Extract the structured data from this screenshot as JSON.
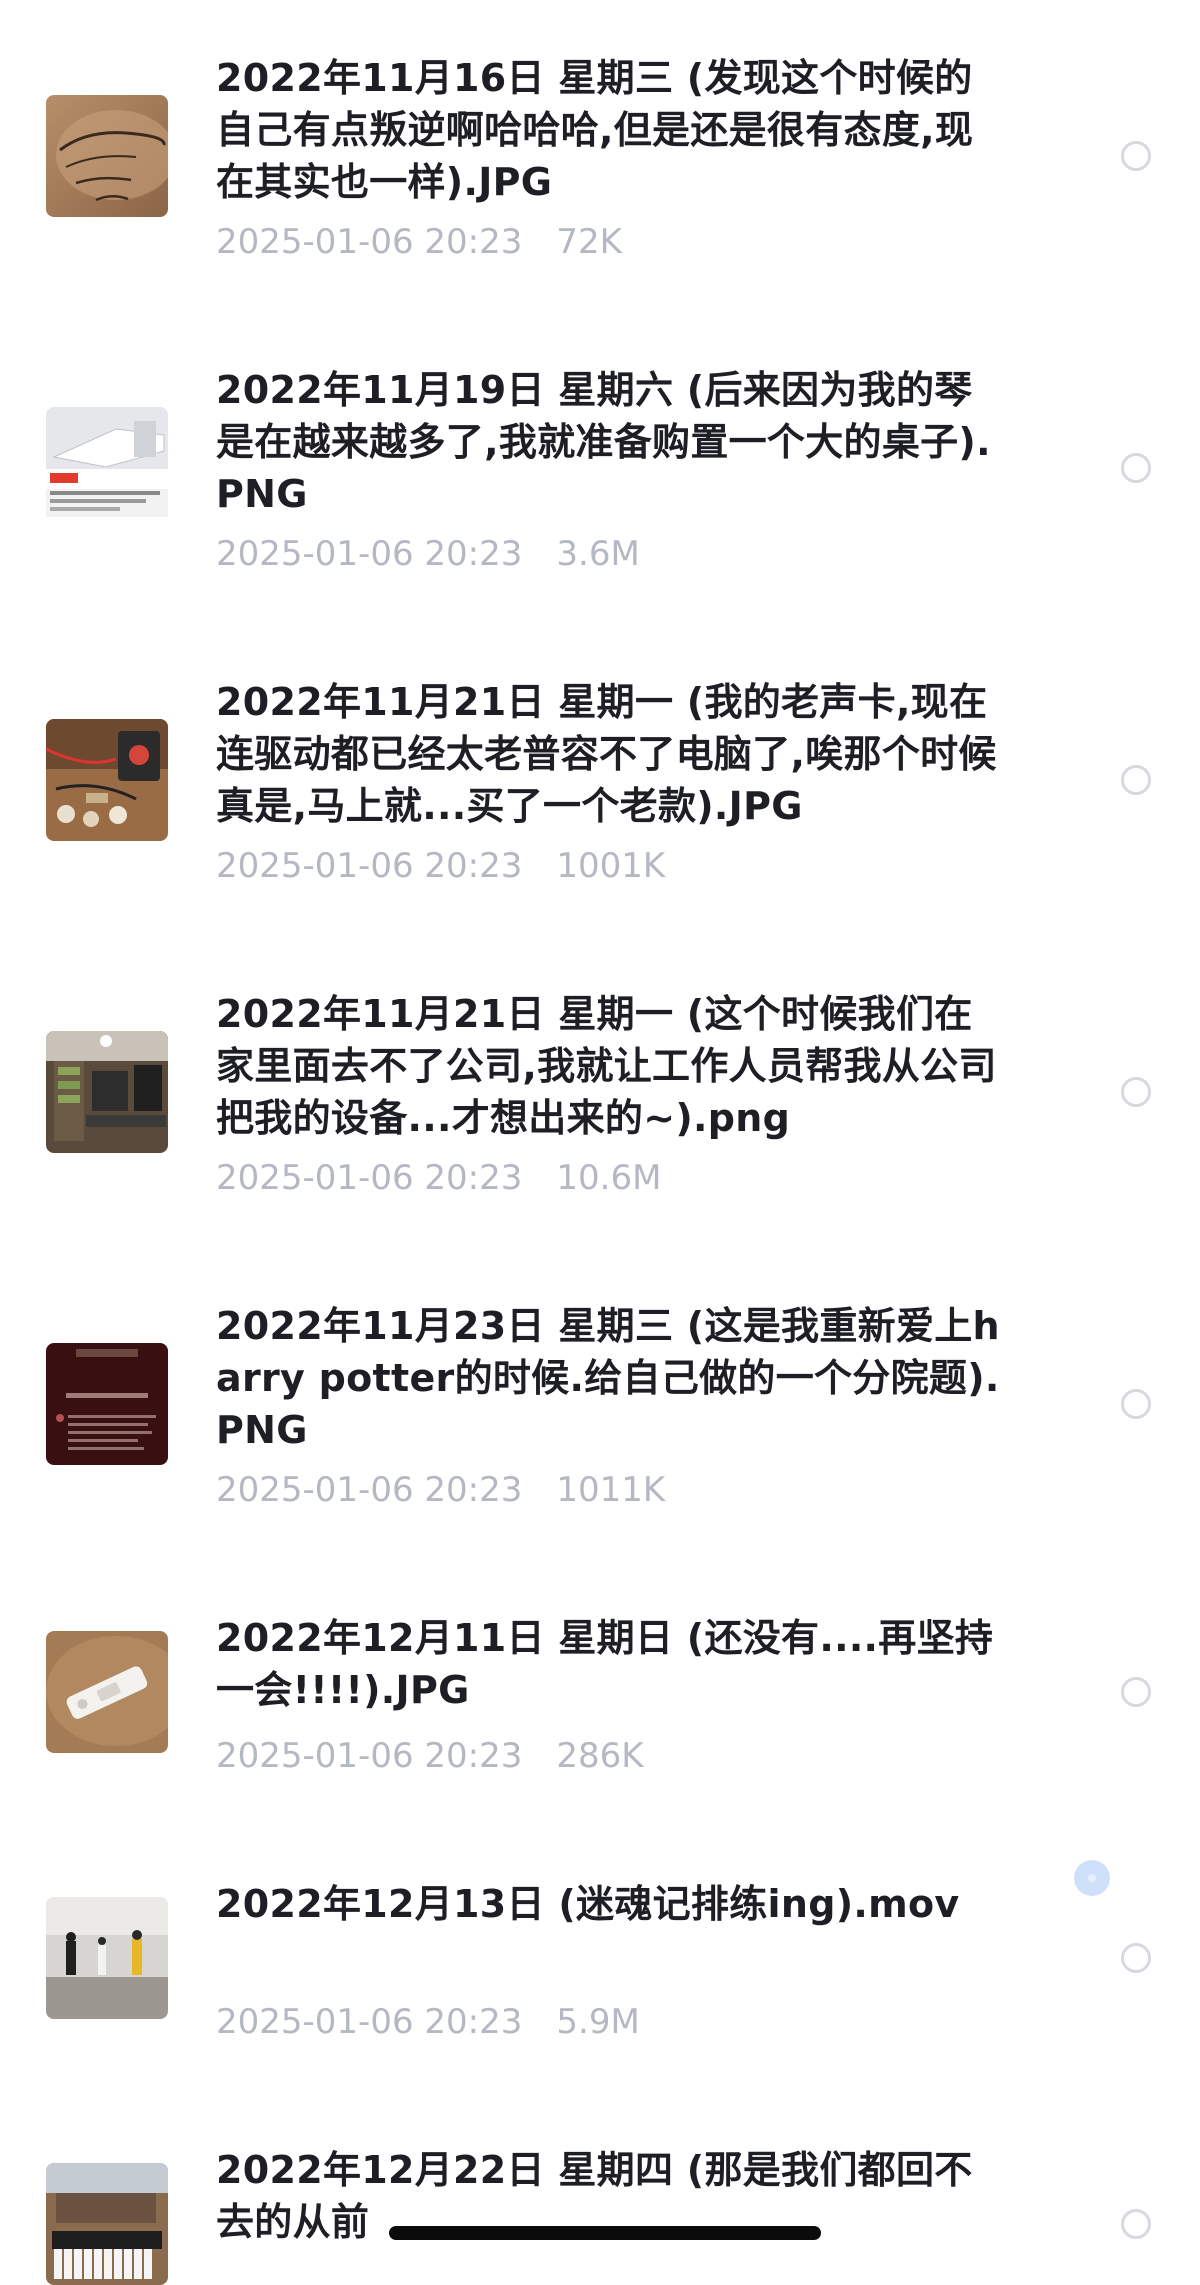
{
  "files": [
    {
      "name": "2022年11月16日 星期三 (发现这个时候的自己有点叛逆啊哈哈哈,但是还是很有态度,现在其实也一样).JPG",
      "date": "2025-01-06 20:23",
      "size": "72K",
      "thumb": "dj-khaled-book-photo"
    },
    {
      "name": "2022年11月19日 星期六 (后来因为我的琴是在越来越多了,我就准备购置一个大的桌子).PNG",
      "date": "2025-01-06 20:23",
      "size": "3.6M",
      "thumb": "desk-shopping-screenshot"
    },
    {
      "name": "2022年11月21日 星期一 (我的老声卡,现在连驱动都已经太老普容不了电脑了,唉那个时候真是,马上就...买了一个老款).JPG",
      "date": "2025-01-06 20:23",
      "size": "1001K",
      "thumb": "sound-card-photo"
    },
    {
      "name": "2022年11月21日 星期一 (这个时候我们在家里面去不了公司,我就让工作人员帮我从公司把我的设备...才想出来的~).png",
      "date": "2025-01-06 20:23",
      "size": "10.6M",
      "thumb": "studio-equipment-photo"
    },
    {
      "name": "2022年11月23日 星期三 (这是我重新爱上harry potter的时候.给自己做的一个分院题).PNG",
      "date": "2025-01-06 20:23",
      "size": "1011K",
      "thumb": "gryffindor-screenshot"
    },
    {
      "name": "2022年12月11日 星期日 (还没有....再坚持一会!!!!).JPG",
      "date": "2025-01-06 20:23",
      "size": "286K",
      "thumb": "test-kit-photo"
    },
    {
      "name": "2022年12月13日 (迷魂记排练ing).mov",
      "date": "2025-01-06 20:23",
      "size": "5.9M",
      "thumb": "rehearsal-video"
    },
    {
      "name": "2022年12月22日 星期四 (那是我们都回不去的从前",
      "date": "",
      "size": "",
      "thumb": "piano-room-photo"
    }
  ],
  "colors": {
    "title": "#1e1f24",
    "meta": "#b4b8c2",
    "radio_border": "#d6d9df",
    "scroll_dot": "#cfe0fb"
  }
}
